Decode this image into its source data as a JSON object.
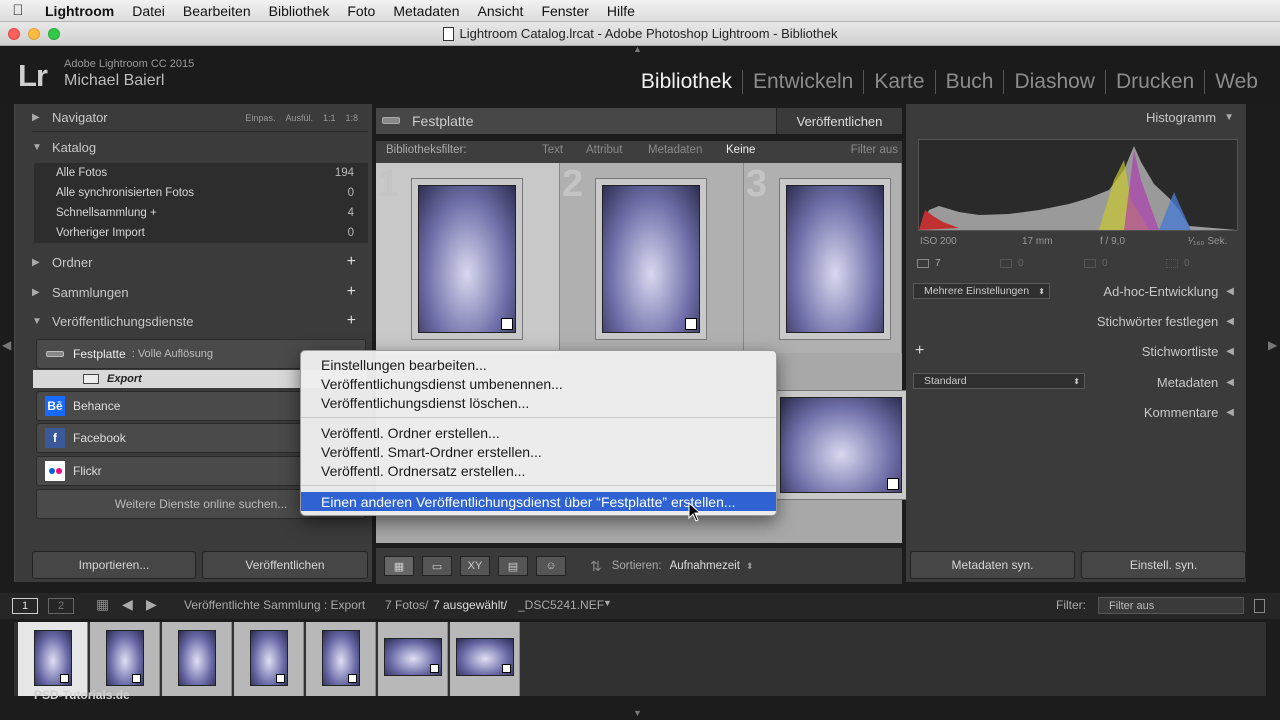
{
  "menubar": {
    "app": "Lightroom",
    "items": [
      "Datei",
      "Bearbeiten",
      "Bibliothek",
      "Foto",
      "Metadaten",
      "Ansicht",
      "Fenster",
      "Hilfe"
    ]
  },
  "window": {
    "title": "Lightroom Catalog.lrcat - Adobe Photoshop Lightroom - Bibliothek"
  },
  "identity": {
    "logo": "Lr",
    "version": "Adobe Lightroom CC 2015",
    "user": "Michael Baierl"
  },
  "modules": [
    "Bibliothek",
    "Entwickeln",
    "Karte",
    "Buch",
    "Diashow",
    "Drucken",
    "Web"
  ],
  "left": {
    "navigator": "Navigator",
    "nav_opts": [
      "Einpas.",
      "Ausfül.",
      "1:1",
      "1:8"
    ],
    "katalog": "Katalog",
    "katalog_rows": [
      {
        "label": "Alle Fotos",
        "count": "194"
      },
      {
        "label": "Alle synchronisierten Fotos",
        "count": "0"
      },
      {
        "label": "Schnellsammlung +",
        "count": "4"
      },
      {
        "label": "Vorheriger Import",
        "count": "0"
      }
    ],
    "ordner": "Ordner",
    "sammlungen": "Sammlungen",
    "publish": "Veröffentlichungsdienste",
    "festplatte": "Festplatte",
    "festplatte_sub": ": Volle Auflösung",
    "export": "Export",
    "behance": "Behance",
    "facebook": "Facebook",
    "flickr": "Flickr",
    "more_services": "Weitere Dienste online suchen...",
    "import_btn": "Importieren...",
    "publish_btn": "Veröffentlichen"
  },
  "center": {
    "title": "Festplatte",
    "publish_btn": "Veröffentlichen",
    "filter_label": "Bibliotheksfilter:",
    "filter_tabs": [
      "Text",
      "Attribut",
      "Metadaten",
      "Keine"
    ],
    "filter_off": "Filter aus",
    "cell_numbers": [
      "1",
      "2",
      "3"
    ],
    "sort_label": "Sortieren:",
    "sort_value": "Aufnahmezeit"
  },
  "context_menu": {
    "items": [
      "Einstellungen bearbeiten...",
      "Veröffentlichungsdienst umbenennen...",
      "Veröffentlichungsdienst löschen...",
      "Veröffentl. Ordner erstellen...",
      "Veröffentl. Smart-Ordner erstellen...",
      "Veröffentl. Ordnersatz erstellen...",
      "Einen anderen Veröffentlichungsdienst über “Festplatte” erstellen..."
    ]
  },
  "right": {
    "histogram": "Histogramm",
    "exif": [
      "ISO 200",
      "17 mm",
      "f / 9,0",
      "¹⁄₁₆₀ Sek."
    ],
    "exif_counts": [
      "7",
      "0",
      "0",
      "0"
    ],
    "preset_select": "Mehrere Einstellungen",
    "adhoc": "Ad-hoc-Entwicklung",
    "keywords": "Stichwörter festlegen",
    "keywordlist": "Stichwortliste",
    "meta_select": "Standard",
    "metadata": "Metadaten",
    "comments": "Kommentare",
    "sync_meta_btn": "Metadaten syn.",
    "sync_settings_btn": "Einstell. syn."
  },
  "filmbar": {
    "views": [
      "1",
      "2"
    ],
    "path": "Veröffentlichte Sammlung : Export",
    "count": "7 Fotos/",
    "selected": "7 ausgewählt/",
    "file": "_DSC5241.NEF",
    "filter_label": "Filter:",
    "filter_value": "Filter aus"
  },
  "watermark": "PSD-Tutorials.de"
}
